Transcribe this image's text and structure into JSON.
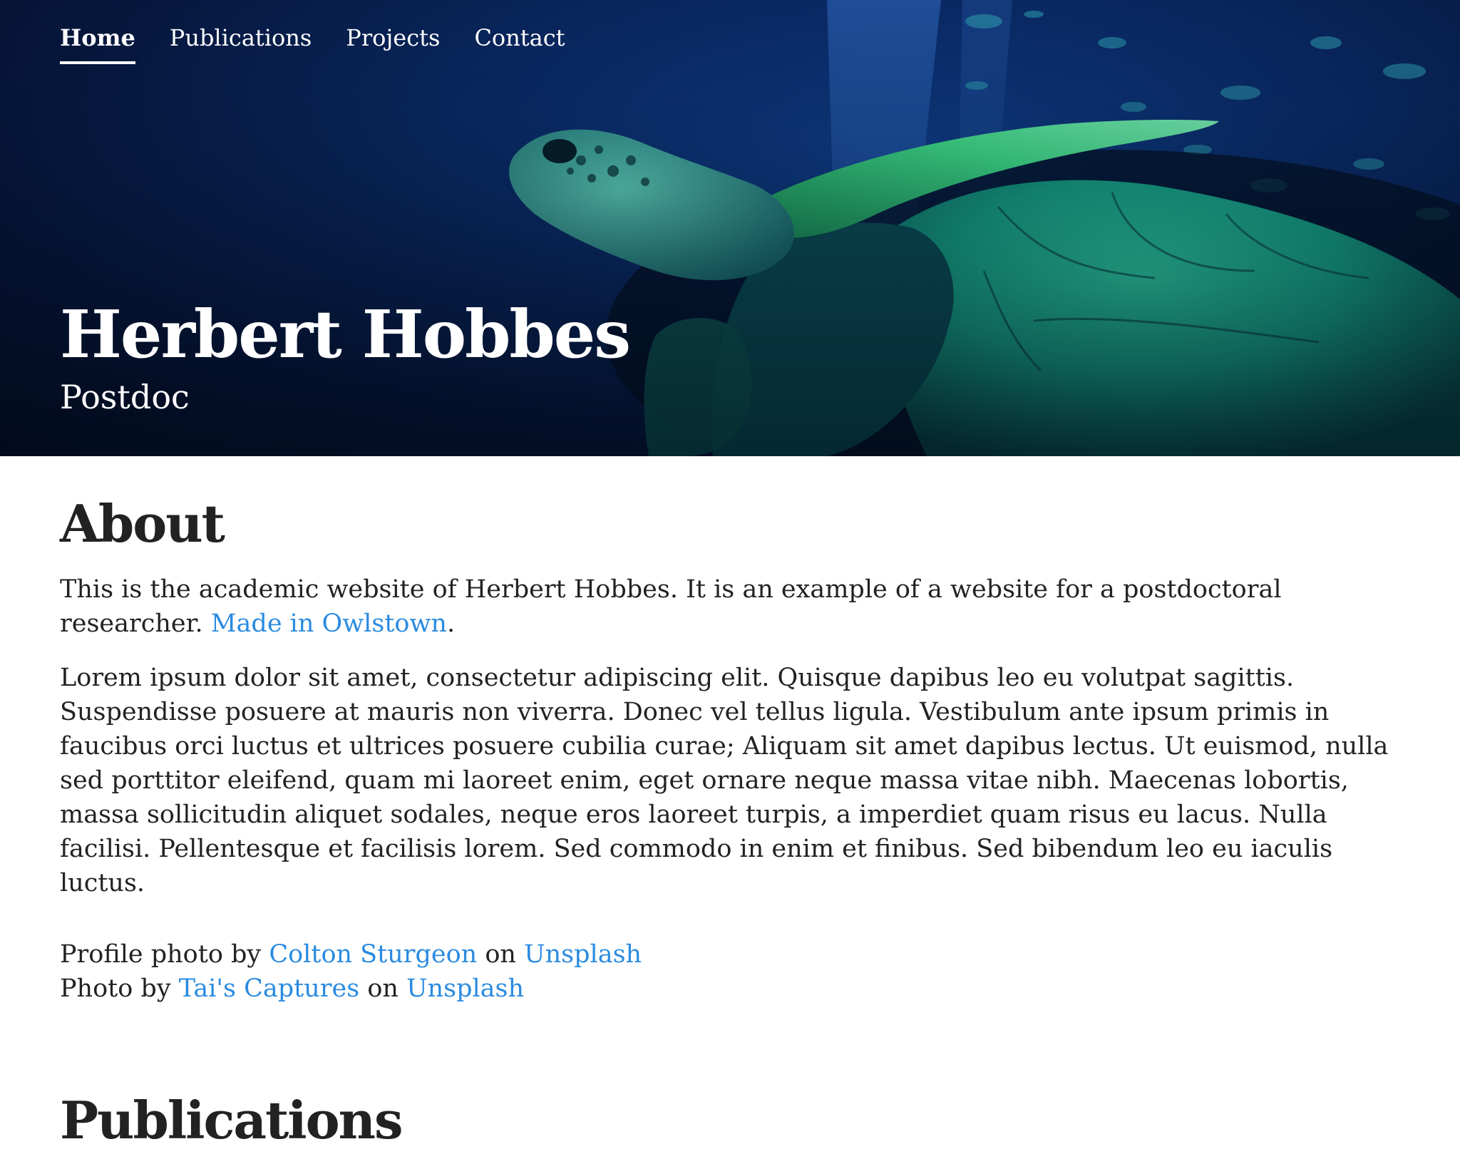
{
  "nav": {
    "items": [
      {
        "label": "Home"
      },
      {
        "label": "Publications"
      },
      {
        "label": "Projects"
      },
      {
        "label": "Contact"
      }
    ]
  },
  "hero": {
    "name": "Herbert Hobbes",
    "role": "Postdoc"
  },
  "about": {
    "heading": "About",
    "intro_text": "This is the academic website of Herbert Hobbes. It is an example of a website for a postdoctoral researcher. ",
    "intro_link": "Made in Owlstown",
    "intro_end": ".",
    "lorem": "Lorem ipsum dolor sit amet, consectetur adipiscing elit. Quisque dapibus leo eu volutpat sagittis. Suspendisse posuere at mauris non viverra. Donec vel tellus ligula. Vestibulum ante ipsum primis in faucibus orci luctus et ultrices posuere cubilia curae; Aliquam sit amet dapibus lectus. Ut euismod, nulla sed porttitor eleifend, quam mi laoreet enim, eget ornare neque massa vitae nibh. Maecenas lobortis, massa sollicitudin aliquet sodales, neque eros laoreet turpis, a imperdiet quam risus eu lacus. Nulla facilisi. Pellentesque et facilisis lorem. Sed commodo in enim et finibus. Sed bibendum leo eu iaculis luctus.",
    "credit1_prefix": "Profile photo by ",
    "credit1_author": "Colton Sturgeon",
    "credit1_mid": " on ",
    "credit1_site": "Unsplash",
    "credit2_prefix": "Photo by ",
    "credit2_author": "Tai's Captures",
    "credit2_mid": " on ",
    "credit2_site": "Unsplash"
  },
  "publications": {
    "heading": "Publications"
  },
  "colors": {
    "link": "#2a8be0",
    "text": "#222222",
    "hero_bg": "#0a2a66"
  }
}
